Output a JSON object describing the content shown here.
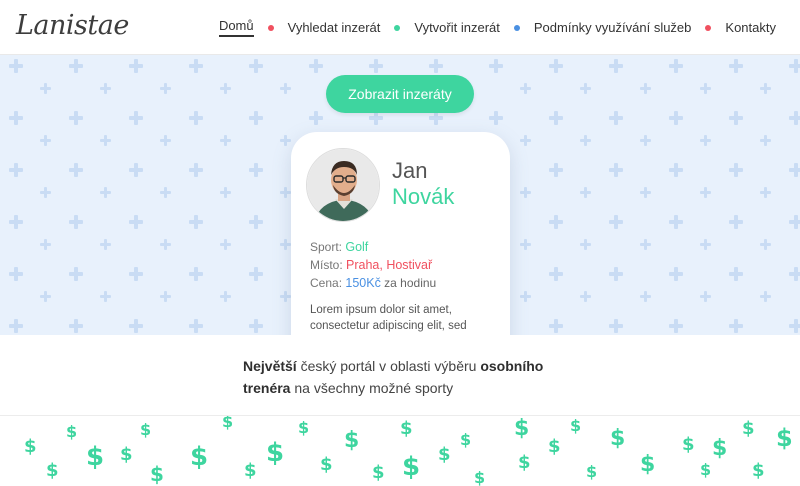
{
  "header": {
    "logo": "Lanistae",
    "nav": [
      {
        "label": "Domů",
        "active": true,
        "dot_after": "#f0505f"
      },
      {
        "label": "Vyhledat inzerát",
        "active": false,
        "dot_after": "#3ed59f"
      },
      {
        "label": "Vytvořit inzerát",
        "active": false,
        "dot_after": "#4a90e2"
      },
      {
        "label": "Podmínky využívání služeb",
        "active": false,
        "dot_after": "#f0505f"
      },
      {
        "label": "Kontakty",
        "active": false,
        "dot_after": null
      }
    ]
  },
  "hero": {
    "cta_label": "Zobrazit inzeráty"
  },
  "card": {
    "first_name": "Jan",
    "last_name": "Novák",
    "sport_label": "Sport:",
    "sport_value": "Golf",
    "place_label": "Místo:",
    "place_value": "Praha, Hostivař",
    "price_label": "Cena:",
    "price_value": "150Kč",
    "price_unit": "za hodinu",
    "description": "Lorem ipsum dolor sit amet, consectetur adipiscing elit, sed"
  },
  "tagline": {
    "part1_bold": "Největší",
    "part2": " český portál v oblasti výběru ",
    "part3_bold": "osobního trenéra",
    "part4": " na všechny možné sporty"
  },
  "colors": {
    "accent_green": "#3ed59f",
    "accent_red": "#f0505f",
    "accent_blue": "#4a90e2",
    "hero_bg": "#e8f1fc",
    "pattern_plus": "#c9dcf4"
  },
  "icons": {
    "hero_pattern": "plus-icon",
    "footer_pattern": "dollar-icon"
  }
}
